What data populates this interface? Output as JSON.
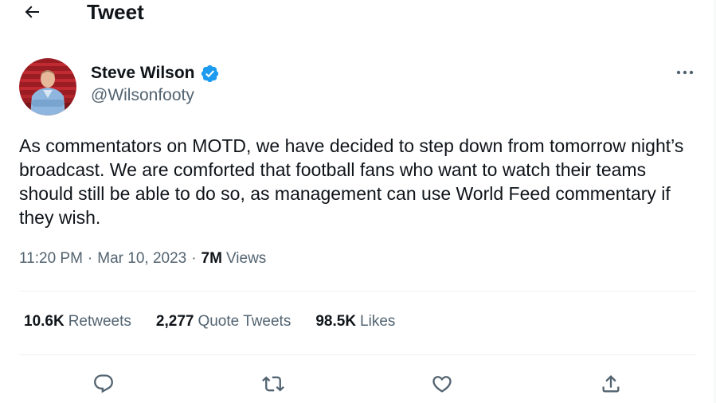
{
  "header": {
    "title": "Tweet",
    "back_icon": "arrow-left-icon"
  },
  "author": {
    "name": "Steve Wilson",
    "handle": "@Wilsonfooty",
    "verified": true,
    "verified_color": "#1d9bf0"
  },
  "tweet": {
    "text": "As commentators on MOTD, we have decided to step down from tomorrow night’s broadcast. We are comforted that football fans who want to watch their teams should still be able to do so, as management can use World Feed commentary if they wish."
  },
  "meta": {
    "time": "11:20 PM",
    "separator": "·",
    "date": "Mar 10, 2023",
    "views_count": "7M",
    "views_label": "Views"
  },
  "stats": {
    "retweets_count": "10.6K",
    "retweets_label": "Retweets",
    "quotes_count": "2,277",
    "quotes_label": "Quote Tweets",
    "likes_count": "98.5K",
    "likes_label": "Likes"
  },
  "actions": {
    "reply_icon": "reply-icon",
    "retweet_icon": "retweet-icon",
    "like_icon": "heart-icon",
    "share_icon": "share-icon"
  },
  "colors": {
    "text_primary": "#0f1419",
    "text_secondary": "#536471",
    "divider": "#eff3f4",
    "accent": "#1d9bf0"
  }
}
